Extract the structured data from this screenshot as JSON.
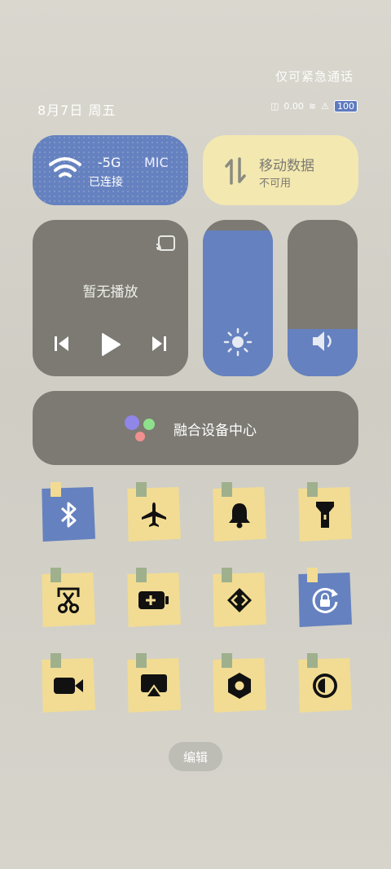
{
  "header": {
    "emergency": "仅可紧急通话",
    "date": "8月7日 周五"
  },
  "status": {
    "battery": "100",
    "signal_text": "0.00",
    "icons": [
      "vibrate-icon",
      "nfc-icon",
      "wifi-signal-icon",
      "alert-icon",
      "battery-icon"
    ]
  },
  "wifi": {
    "name": "-5G",
    "extra": "MIC",
    "state": "已连接"
  },
  "mobile_data": {
    "title": "移动数据",
    "state": "不可用"
  },
  "media": {
    "status": "暂无播放"
  },
  "sliders": {
    "brightness_level": 0.93,
    "volume_level": 0.3
  },
  "fusion": {
    "label": "融合设备中心"
  },
  "toggles": [
    "bluetooth-icon",
    "airplane-icon",
    "bell-icon",
    "flashlight-icon",
    "screenshot-icon",
    "battery-saver-icon",
    "connect-icon",
    "rotation-lock-icon",
    "screen-record-icon",
    "screencast-icon",
    "settings-hex-icon",
    "dark-mode-icon"
  ],
  "edit_label": "编辑",
  "colors": {
    "blue": "#6581bf",
    "yellow": "#f2dc93",
    "gray": "#7c7a73"
  }
}
